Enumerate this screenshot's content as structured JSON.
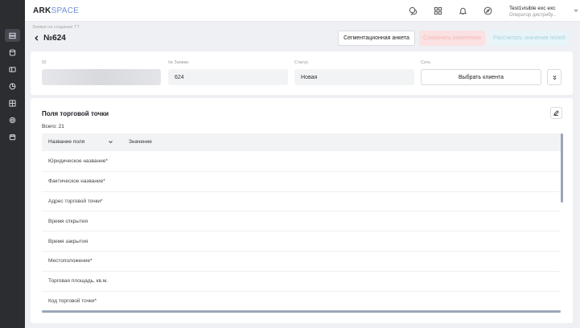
{
  "topbar": {
    "logo_main": "ARK",
    "logo_sub": "SPACE",
    "user_name": "Test1visible exc exc",
    "user_role": "Оператор дистрибу..."
  },
  "breadcrumb": "Заявки на создание ТТ",
  "page_title": "№624",
  "actions": {
    "segment": "Сегментационная анкета",
    "save": "Сохранить изменения",
    "calc": "Рассчитать значения полей"
  },
  "info": {
    "id_label": "ID",
    "num_label": "№ Заявки",
    "num_value": "624",
    "status_label": "Статус",
    "status_value": "Новая",
    "network_label": "Сеть",
    "client_button": "Выбрать клиента"
  },
  "fields": {
    "title": "Поля торговой точки",
    "total": "Всего: 21",
    "col_name": "Название поля",
    "col_value": "Значение",
    "rows": [
      "Юридическое название*",
      "Фактическое название*",
      "Адрес торговой точки*",
      "Время открытия",
      "Время закрытия",
      "Местоположение*",
      "Торговая площадь, кв.м.",
      "Код торговой точки*"
    ]
  }
}
